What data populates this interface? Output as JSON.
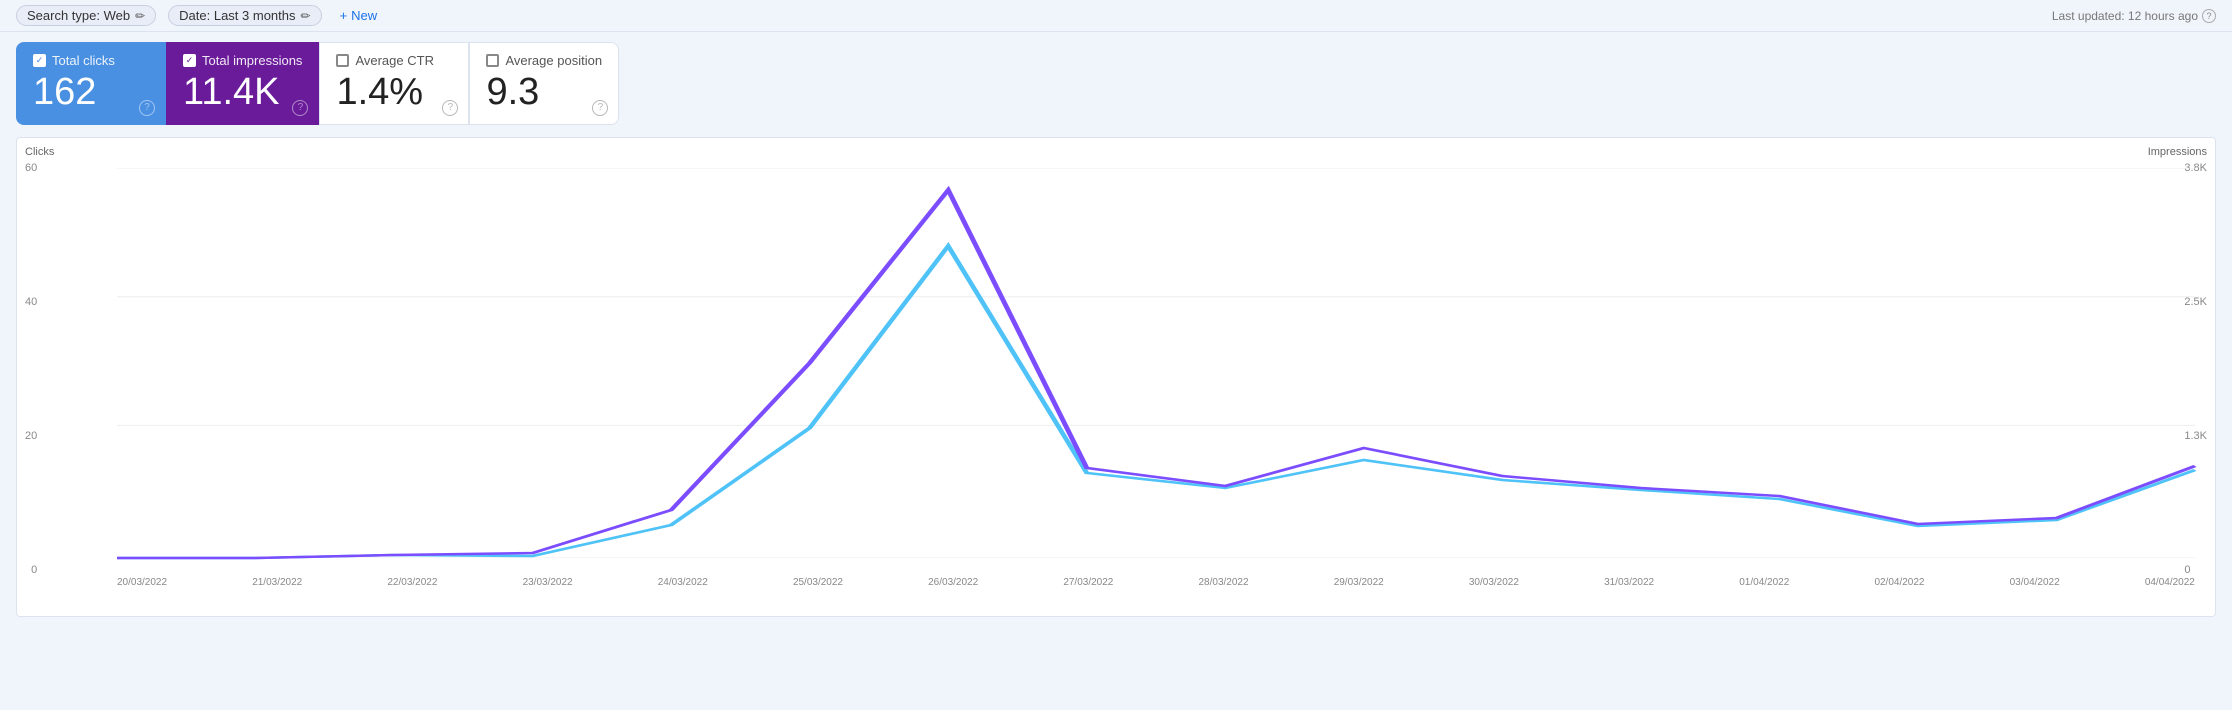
{
  "topbar": {
    "search_type_label": "Search type: Web",
    "date_label": "Date: Last 3 months",
    "new_button": "New",
    "last_updated": "Last updated: 12 hours ago",
    "edit_icon": "✏"
  },
  "metrics": {
    "total_clicks": {
      "label": "Total clicks",
      "value": "162",
      "checked": true,
      "color": "blue"
    },
    "total_impressions": {
      "label": "Total impressions",
      "value": "11.4K",
      "checked": true,
      "color": "purple"
    },
    "average_ctr": {
      "label": "Average CTR",
      "value": "1.4%",
      "checked": false,
      "color": "none"
    },
    "average_position": {
      "label": "Average position",
      "value": "9.3",
      "checked": false,
      "color": "none"
    }
  },
  "chart": {
    "y_left_title": "Clicks",
    "y_right_title": "Impressions",
    "y_left_labels": [
      "60",
      "40",
      "20",
      "0"
    ],
    "y_right_labels": [
      "3.8K",
      "2.5K",
      "1.3K",
      "0"
    ],
    "x_labels": [
      "20/03/2022",
      "21/03/2022",
      "22/03/2022",
      "23/03/2022",
      "24/03/2022",
      "25/03/2022",
      "26/03/2022",
      "27/03/2022",
      "28/03/2022",
      "29/03/2022",
      "30/03/2022",
      "31/03/2022",
      "01/04/2022",
      "02/04/2022",
      "03/04/2022",
      "04/04/2022"
    ]
  },
  "icons": {
    "help": "?",
    "plus": "+",
    "edit": "✏",
    "check": "✓"
  }
}
